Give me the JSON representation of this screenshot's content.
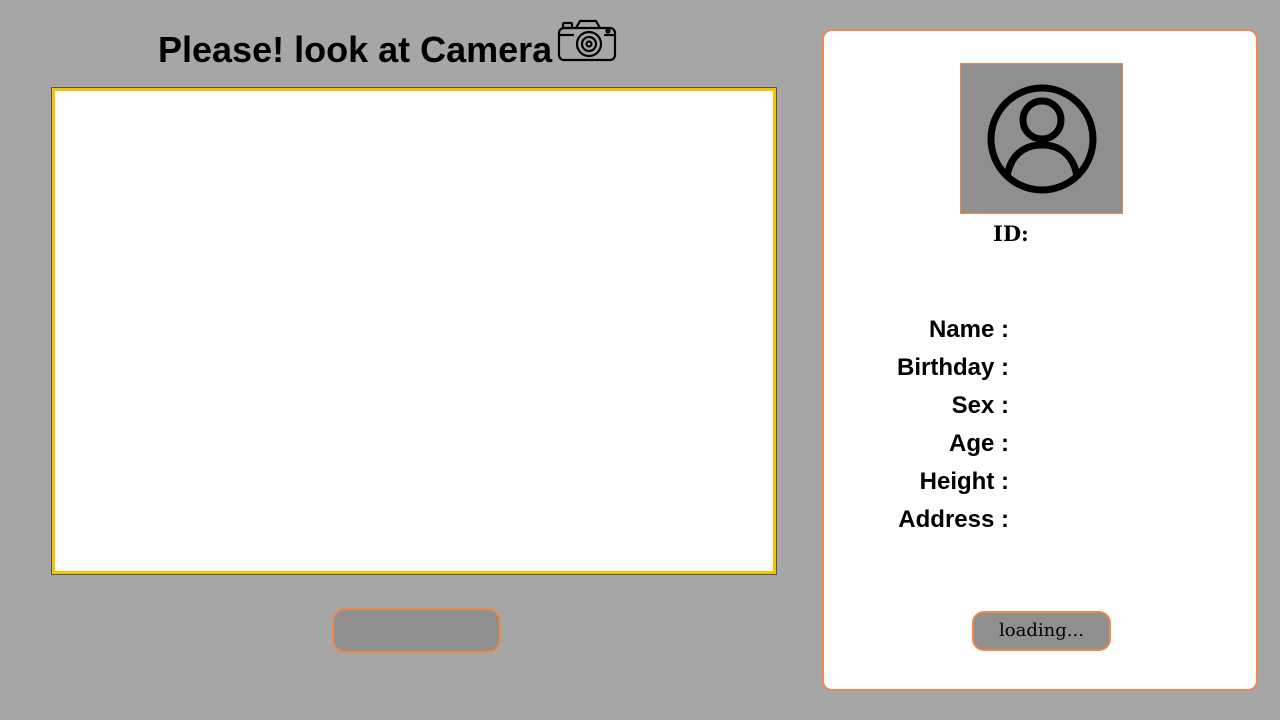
{
  "header": {
    "title": "Please! look at Camera",
    "camera_icon": "camera-icon"
  },
  "video": {
    "frame_color": "#f5c400"
  },
  "capture_button": {
    "label": ""
  },
  "profile": {
    "avatar_icon": "user-avatar-icon",
    "id_label": "ID:",
    "fields": [
      {
        "label": "Name :"
      },
      {
        "label": "Birthday :"
      },
      {
        "label": "Sex :"
      },
      {
        "label": "Age :"
      },
      {
        "label": "Height :"
      },
      {
        "label": "Address :"
      }
    ],
    "status_button": "loading..."
  },
  "colors": {
    "background": "#a6a6a6",
    "accent_border": "#f0894a",
    "button_fill": "#8f8f8f",
    "card": "#ffffff"
  }
}
